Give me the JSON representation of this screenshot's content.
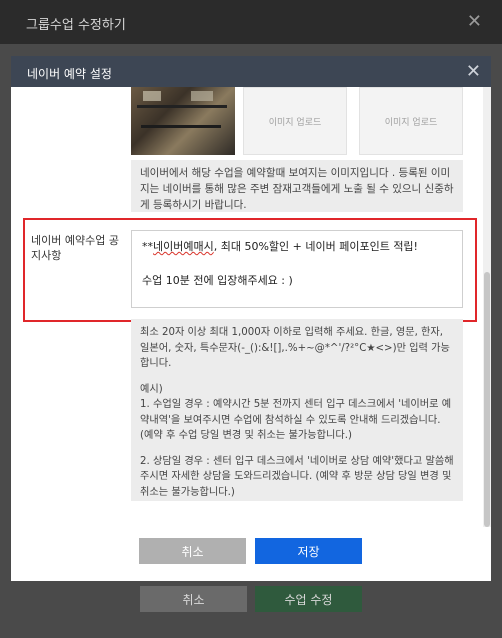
{
  "outer_modal": {
    "title": "그룹수업 수정하기",
    "close_glyph": "✕",
    "cancel_label": "취소",
    "submit_label": "수업 수정"
  },
  "modal": {
    "title": "네이버 예약 설정",
    "close_glyph": "✕"
  },
  "images": {
    "upload_label_1": "이미지 업로드",
    "upload_label_2": "이미지 업로드"
  },
  "image_info": "네이버에서 해당 수업을 예약할때 보여지는 이미지입니다 . 등록된 이미지는 네이버를 통해 많은 주변 잠재고객들에게 노출 될 수 있으니 신중하게 등록하시기 바랍니다.",
  "notice_field": {
    "label": "네이버 예약수업 공지사항",
    "line1_prefix": "**",
    "line1_underlined": "네이버예매시",
    "line1_rest": ", 최대 50%할인 + 네이버 페이포인트 적립!",
    "line2": "수업 10분 전에 입장해주세요 : )"
  },
  "help": {
    "rule": "최소 20자 이상 최대 1,000자 이하로 입력해 주세요. 한글, 영문, 한자, 일본어, 숫자, 특수문자(-_():&![],.%+~@*^'/?²°C★<>)만 입력 가능합니다.",
    "example_title": "예시)",
    "example_1": "1. 수업일 경우 : 예약시간 5분 전까지 센터 입구 데스크에서 '네이버로 예약내역'을 보여주시면 수업에 참석하실 수 있도록 안내해 드리겠습니다. (예약 후 수업 당일 변경 및 취소는 불가능합니다.)",
    "example_2": "2. 상담일 경우 : 센터 입구 데스크에서 '네이버로 상담 예약'했다고 말씀해주시면 자세한 상담을 도와드리겠습니다. (예약 후 방문 상담 당일 변경 및 취소는 불가능합니다.)"
  },
  "buttons": {
    "cancel_label": "취소",
    "save_label": "저장"
  },
  "colors": {
    "modal_header": "#3d4654",
    "save_button": "#1266e0",
    "highlight_border": "#e0262a"
  }
}
